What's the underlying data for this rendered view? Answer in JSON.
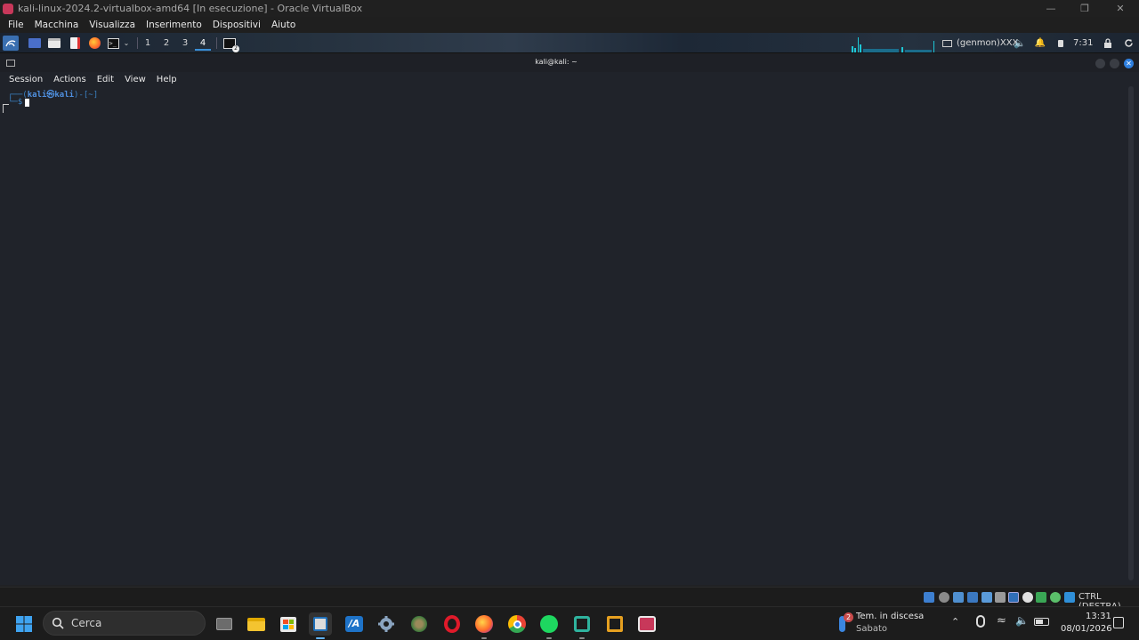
{
  "host": {
    "title": "kali-linux-2024.2-virtualbox-amd64 [In esecuzione] - Oracle VirtualBox",
    "menu": [
      "File",
      "Macchina",
      "Visualizza",
      "Inserimento",
      "Dispositivi",
      "Aiuto"
    ]
  },
  "panel": {
    "workspaces": [
      "1",
      "2",
      "3",
      "4"
    ],
    "active_workspace": "4",
    "genmon": "(genmon)XXX",
    "clock": "7:31"
  },
  "terminal": {
    "title": "kali@kali: ~",
    "menu": [
      "Session",
      "Actions",
      "Edit",
      "View",
      "Help"
    ],
    "prompt_line1_prefix": "┌──(",
    "prompt_user": "kali㉿kali",
    "prompt_line1_suffix": ")-[~]",
    "prompt_line2": "└─$"
  },
  "vbox_status": {
    "host_key": "CTRL (DESTRA)"
  },
  "taskbar": {
    "search_placeholder": "Cerca",
    "weather_title": "Tem. in discesa",
    "weather_day": "Sabato",
    "weather_badge": "2",
    "time": "13:31",
    "date": "08/01/2026"
  },
  "colors": {
    "accent": "#3a8fd8",
    "prompt": "#3b82c4",
    "terminal_bg": "#20232a"
  }
}
